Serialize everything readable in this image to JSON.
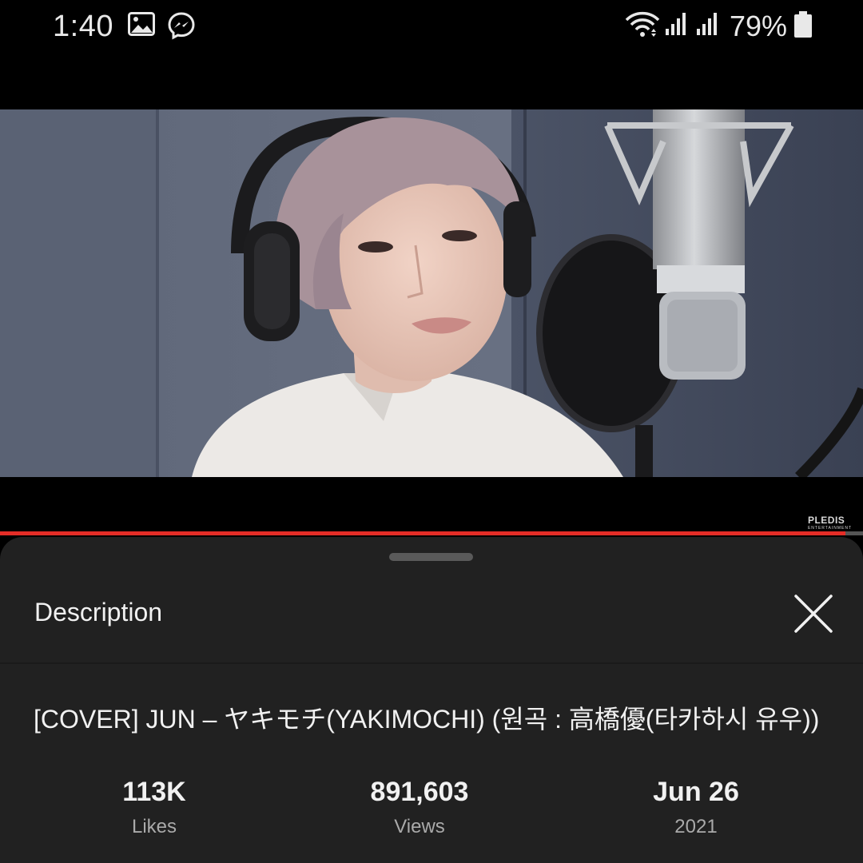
{
  "status_bar": {
    "time": "1:40",
    "battery": "79%",
    "icons": [
      "image-icon",
      "messenger-icon",
      "wifi-icon",
      "signal-icon",
      "signal-icon",
      "battery-icon"
    ]
  },
  "video": {
    "watermark": "PLEDIS",
    "watermark_sub": "ENTERTAINMENT",
    "progress": 0.98,
    "accent_color": "#e52d27"
  },
  "sheet": {
    "title": "Description",
    "close_icon": "close-icon",
    "video_title": "[COVER] JUN – ヤキモチ(YAKIMOCHI) (원곡 : 高橋優(타카하시 유우))",
    "stats": [
      {
        "value": "113K",
        "label": "Likes"
      },
      {
        "value": "891,603",
        "label": "Views"
      },
      {
        "value": "Jun 26",
        "label": "2021"
      }
    ]
  }
}
